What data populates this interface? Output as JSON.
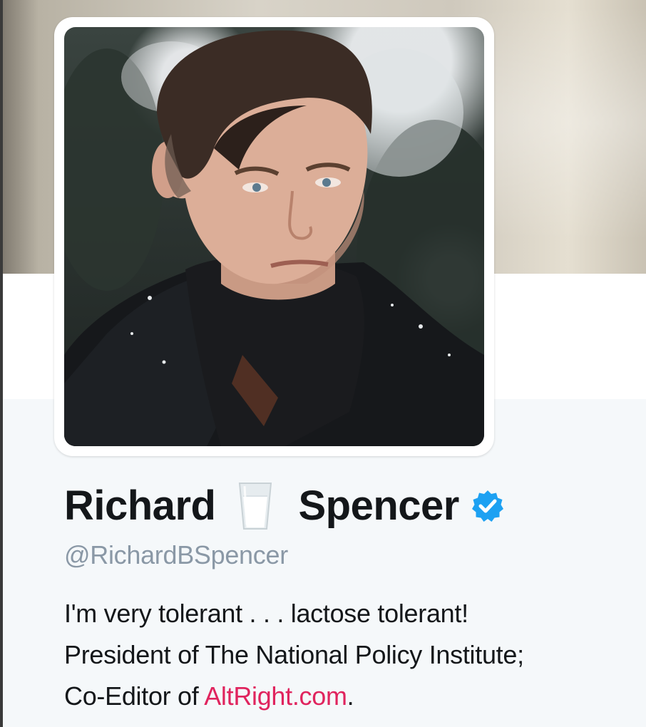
{
  "profile": {
    "name_first": "Richard",
    "name_last": "Spencer",
    "name_emoji": "glass-of-milk-icon",
    "verified": true,
    "verified_icon": "verified-badge-icon",
    "handle": "@RichardBSpencer",
    "bio": {
      "line1": "I'm very tolerant . . . lactose tolerant!",
      "line2": "President of The National Policy Institute;",
      "line3_prefix": "Co-Editor of ",
      "line3_link": "AltRight.com",
      "line3_suffix": "."
    }
  },
  "colors": {
    "text_primary": "#14171a",
    "text_secondary": "#8a98a6",
    "link": "#e0245e",
    "verified_blue": "#1da1f2",
    "background": "#f5f8fa"
  },
  "images": {
    "avatar": "profile-photo",
    "banner": "header-photo"
  }
}
